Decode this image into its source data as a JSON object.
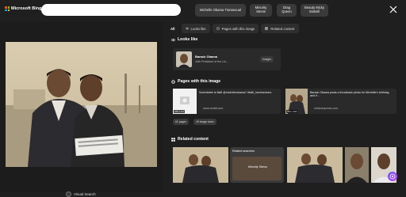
{
  "brand": {
    "name": "Microsoft Bing",
    "colors": [
      "#f25022",
      "#7fba00",
      "#00a4ef",
      "#ffb900"
    ]
  },
  "search": {
    "value": "",
    "placeholder": ""
  },
  "related_pills": [
    "Michelle Obama Transexual",
    "Minority Stress",
    "Drag Queen",
    "Beauty Micky Stoksill"
  ],
  "viewer": {
    "visual_search_label": "Visual Search"
  },
  "tabs": [
    {
      "label": "All",
      "icon": ""
    },
    {
      "label": "Looks like",
      "icon": "eye-icon"
    },
    {
      "label": "Pages with this image",
      "icon": "globe-icon"
    },
    {
      "label": "Related content",
      "icon": "grid-icon"
    }
  ],
  "looks_like": {
    "title": "Looks like",
    "entity_name": "Barack Obama",
    "entity_desc": "44th President of the Un...",
    "images_button": "Images"
  },
  "pages": {
    "title": "Pages with this image",
    "items": [
      {
        "text": "Szerintetek is fiatfl @michelleobama? #fatfi_hamfuevesrs",
        "source": "www.reddit.com",
        "size": "476 x 271"
      },
      {
        "text": "Barack Obama posts a throwback photo for Michelle's birthday, and it ...",
        "source": "indianexpress.com",
        "size": "750 x 432"
      }
    ],
    "chips": [
      "62 pages",
      "49 image sizes"
    ]
  },
  "related": {
    "title": "Related content",
    "searches_label": "Related searches",
    "search_chip": "Minority Stress"
  }
}
